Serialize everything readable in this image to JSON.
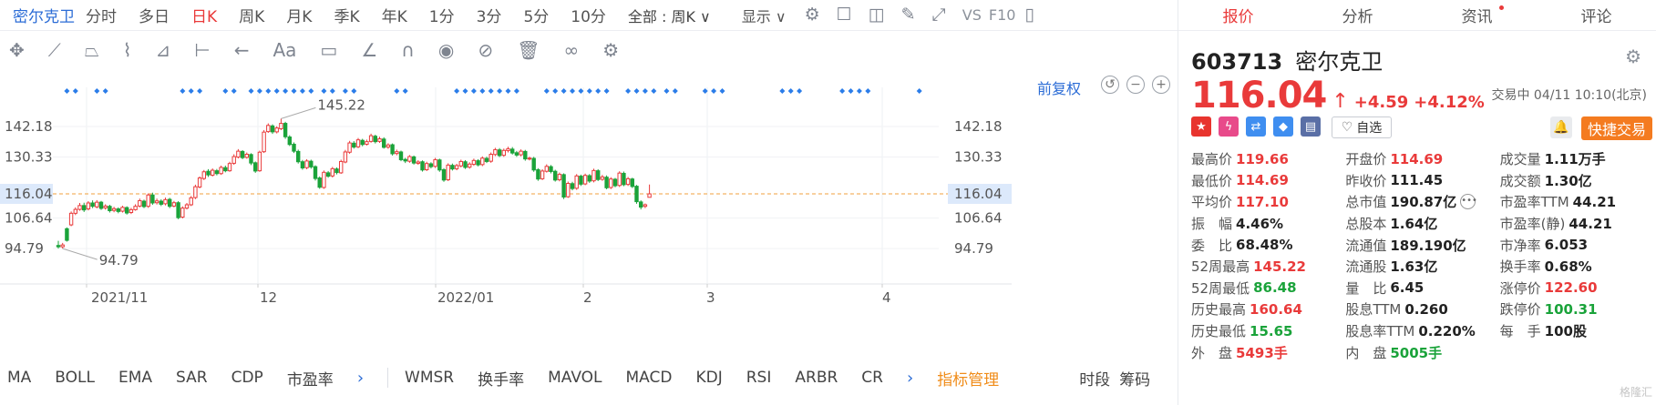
{
  "stock": {
    "name": "密尔克卫",
    "code": "603713"
  },
  "period_bar": {
    "periods": [
      "分时",
      "多日",
      "日K",
      "周K",
      "月K",
      "季K",
      "年K",
      "1分",
      "3分",
      "5分",
      "10分"
    ],
    "active_period": "日K",
    "range_select": "全部 : 周K ∨",
    "display_label": "显示 ∨",
    "vs_label": "VS",
    "f10_label": "F10"
  },
  "chart": {
    "adjust_label": "前复权",
    "price_labels": [
      "142.18",
      "130.33",
      "116.04",
      "106.64",
      "94.79"
    ],
    "current_price_tag": "116.04",
    "high_annotation": "145.22",
    "low_annotation": "94.79",
    "x_labels": [
      "2021/11",
      "12",
      "2022/01",
      "2",
      "3",
      "4"
    ],
    "colors": {
      "up": "#e93a3a",
      "down": "#1aa33a",
      "signal": "#2b7de9",
      "reference_line": "#f0a03c",
      "price_tag_bg": "#dce9fb"
    }
  },
  "chart_data": {
    "type": "candlestick",
    "x_labels": [
      "2021/11",
      "12",
      "2022/01",
      "2",
      "3",
      "4"
    ],
    "y_ticks": [
      142.18,
      130.33,
      116.04,
      106.64,
      94.79
    ],
    "high": 145.22,
    "low": 94.79,
    "current": 116.04,
    "candles": [
      [
        96.0,
        95.5,
        97.8,
        94.8
      ],
      [
        95.5,
        96.2,
        97.0,
        94.79
      ],
      [
        102.5,
        98.0,
        103.0,
        97.5
      ],
      [
        104.0,
        108.5,
        109.2,
        103.5
      ],
      [
        108.5,
        110.0,
        110.8,
        107.8
      ],
      [
        110.0,
        111.5,
        112.5,
        109.5
      ],
      [
        111.5,
        109.8,
        112.6,
        109.0
      ],
      [
        110.2,
        112.5,
        113.2,
        109.6
      ],
      [
        112.5,
        111.2,
        113.5,
        110.5
      ],
      [
        111.0,
        112.8,
        113.6,
        110.4
      ],
      [
        112.8,
        110.4,
        113.3,
        109.8
      ],
      [
        110.6,
        111.3,
        112.0,
        109.9
      ],
      [
        111.2,
        109.5,
        111.8,
        108.8
      ],
      [
        109.6,
        110.3,
        111.0,
        108.9
      ],
      [
        110.2,
        109.2,
        110.8,
        108.5
      ],
      [
        109.3,
        110.8,
        111.4,
        108.8
      ],
      [
        110.7,
        108.6,
        111.2,
        108.0
      ],
      [
        108.8,
        109.9,
        110.6,
        108.2
      ],
      [
        109.9,
        111.2,
        112.0,
        109.5
      ],
      [
        111.3,
        113.4,
        114.2,
        110.8
      ],
      [
        113.2,
        111.1,
        113.8,
        110.5
      ],
      [
        111.2,
        115.6,
        116.2,
        110.6
      ],
      [
        115.6,
        112.5,
        116.5,
        111.8
      ],
      [
        112.6,
        113.3,
        114.2,
        111.9
      ],
      [
        113.2,
        112.0,
        113.9,
        111.3
      ],
      [
        112.2,
        113.8,
        114.6,
        111.6
      ],
      [
        113.9,
        111.2,
        114.5,
        110.5
      ],
      [
        111.3,
        112.6,
        113.3,
        110.8
      ],
      [
        112.6,
        106.8,
        113.2,
        106.2
      ],
      [
        107.0,
        110.5,
        111.2,
        106.5
      ],
      [
        110.5,
        111.8,
        112.5,
        110.0
      ],
      [
        111.8,
        114.5,
        115.2,
        111.3
      ],
      [
        114.6,
        118.8,
        119.6,
        114.0
      ],
      [
        118.7,
        122.2,
        122.8,
        118.2
      ],
      [
        122.0,
        124.6,
        125.3,
        121.4
      ],
      [
        124.8,
        123.4,
        125.6,
        122.6
      ],
      [
        123.3,
        125.2,
        125.9,
        122.8
      ],
      [
        125.0,
        123.9,
        125.7,
        123.2
      ],
      [
        123.9,
        126.3,
        127.0,
        123.4
      ],
      [
        126.2,
        125.0,
        127.0,
        124.4
      ],
      [
        125.0,
        127.8,
        128.5,
        124.6
      ],
      [
        127.9,
        130.5,
        131.4,
        127.3
      ],
      [
        130.3,
        132.6,
        133.4,
        129.8
      ],
      [
        132.5,
        130.1,
        133.0,
        129.5
      ],
      [
        130.2,
        131.4,
        132.1,
        129.7
      ],
      [
        131.3,
        128.0,
        131.8,
        127.2
      ],
      [
        128.1,
        124.9,
        128.6,
        124.2
      ],
      [
        125.0,
        132.2,
        132.8,
        124.6
      ],
      [
        132.4,
        140.0,
        140.8,
        131.9
      ],
      [
        140.2,
        142.6,
        143.4,
        139.7
      ],
      [
        142.4,
        140.1,
        143.0,
        139.3
      ],
      [
        140.1,
        141.6,
        142.3,
        139.5
      ],
      [
        141.3,
        143.4,
        145.22,
        140.8
      ],
      [
        143.4,
        138.2,
        144.0,
        137.4
      ],
      [
        138.1,
        135.2,
        138.8,
        134.6
      ],
      [
        135.3,
        132.6,
        136.0,
        131.9
      ],
      [
        132.5,
        128.5,
        133.2,
        127.8
      ],
      [
        128.5,
        126.1,
        129.2,
        125.4
      ],
      [
        126.2,
        128.8,
        129.5,
        125.6
      ],
      [
        128.7,
        126.5,
        129.3,
        125.8
      ],
      [
        126.6,
        122.0,
        127.1,
        121.2
      ],
      [
        122.2,
        118.6,
        122.8,
        118.0
      ],
      [
        118.5,
        124.4,
        125.1,
        118.0
      ],
      [
        124.2,
        122.9,
        124.9,
        122.3
      ],
      [
        123.0,
        125.8,
        126.5,
        122.4
      ],
      [
        125.7,
        124.3,
        126.3,
        123.6
      ],
      [
        124.2,
        128.6,
        129.3,
        123.8
      ],
      [
        128.4,
        132.3,
        133.1,
        127.9
      ],
      [
        132.2,
        135.8,
        136.6,
        131.6
      ],
      [
        135.7,
        134.2,
        136.5,
        133.6
      ],
      [
        134.3,
        137.0,
        137.7,
        133.8
      ],
      [
        136.8,
        135.2,
        137.4,
        134.5
      ],
      [
        135.3,
        136.3,
        137.1,
        134.8
      ],
      [
        136.4,
        138.6,
        139.4,
        135.9
      ],
      [
        138.4,
        136.3,
        139.0,
        135.6
      ],
      [
        136.4,
        137.4,
        138.2,
        135.8
      ],
      [
        137.3,
        134.1,
        138.0,
        133.6
      ],
      [
        134.2,
        135.0,
        135.7,
        133.5
      ],
      [
        135.1,
        131.6,
        135.6,
        130.9
      ],
      [
        131.7,
        132.4,
        133.2,
        131.0
      ],
      [
        132.3,
        129.3,
        132.8,
        128.7
      ],
      [
        129.4,
        128.8,
        130.0,
        128.0
      ],
      [
        128.7,
        130.5,
        131.1,
        128.1
      ],
      [
        130.4,
        128.0,
        130.9,
        127.4
      ],
      [
        127.9,
        128.4,
        129.1,
        127.3
      ],
      [
        128.5,
        125.3,
        129.0,
        124.7
      ],
      [
        125.4,
        127.8,
        128.5,
        124.9
      ],
      [
        127.7,
        126.6,
        128.3,
        125.9
      ],
      [
        126.7,
        129.3,
        130.0,
        126.1
      ],
      [
        129.2,
        125.3,
        129.7,
        124.6
      ],
      [
        125.4,
        121.4,
        126.0,
        120.7
      ],
      [
        121.5,
        127.2,
        127.9,
        121.0
      ],
      [
        127.1,
        125.7,
        127.8,
        125.1
      ],
      [
        125.8,
        127.0,
        127.7,
        125.2
      ],
      [
        126.9,
        128.6,
        129.3,
        126.3
      ],
      [
        128.5,
        126.3,
        129.1,
        125.7
      ],
      [
        126.4,
        127.6,
        128.3,
        125.8
      ],
      [
        127.5,
        129.0,
        129.7,
        126.9
      ],
      [
        128.9,
        127.3,
        129.5,
        126.7
      ],
      [
        127.4,
        129.9,
        130.6,
        126.8
      ],
      [
        129.8,
        128.6,
        130.5,
        128.0
      ],
      [
        128.7,
        131.4,
        132.1,
        128.1
      ],
      [
        131.3,
        133.2,
        133.9,
        130.7
      ],
      [
        133.1,
        130.9,
        133.8,
        130.3
      ],
      [
        131.0,
        132.9,
        133.6,
        130.4
      ],
      [
        132.8,
        133.5,
        134.3,
        132.1
      ],
      [
        133.4,
        131.9,
        134.2,
        131.3
      ],
      [
        132.0,
        131.1,
        132.7,
        130.4
      ],
      [
        131.2,
        132.6,
        133.3,
        130.6
      ],
      [
        132.5,
        129.6,
        133.1,
        128.9
      ],
      [
        129.7,
        129.9,
        130.5,
        129.0
      ],
      [
        129.8,
        125.3,
        130.4,
        124.6
      ],
      [
        125.4,
        121.8,
        126.0,
        121.1
      ],
      [
        121.9,
        124.9,
        125.6,
        121.4
      ],
      [
        124.8,
        126.7,
        127.5,
        124.3
      ],
      [
        126.6,
        124.7,
        127.2,
        124.0
      ],
      [
        124.8,
        121.4,
        125.4,
        120.8
      ],
      [
        121.5,
        123.6,
        124.3,
        120.9
      ],
      [
        123.5,
        114.8,
        124.0,
        114.0
      ],
      [
        114.9,
        120.1,
        120.8,
        114.5
      ],
      [
        120.0,
        118.1,
        120.7,
        117.4
      ],
      [
        118.2,
        123.0,
        123.7,
        117.6
      ],
      [
        122.9,
        119.8,
        123.5,
        119.1
      ],
      [
        119.9,
        123.2,
        123.9,
        119.4
      ],
      [
        123.1,
        121.0,
        123.7,
        120.3
      ],
      [
        121.1,
        125.1,
        125.8,
        120.5
      ],
      [
        125.0,
        121.6,
        125.6,
        121.0
      ],
      [
        121.7,
        122.6,
        123.4,
        121.1
      ],
      [
        122.5,
        118.4,
        123.2,
        117.8
      ],
      [
        118.5,
        121.8,
        122.5,
        117.9
      ],
      [
        121.7,
        119.2,
        122.2,
        118.6
      ],
      [
        119.3,
        124.1,
        124.8,
        118.7
      ],
      [
        124.0,
        119.6,
        124.7,
        119.0
      ],
      [
        119.7,
        121.9,
        122.6,
        119.1
      ],
      [
        121.8,
        118.9,
        122.3,
        118.3
      ],
      [
        119.0,
        113.0,
        119.5,
        112.2
      ],
      [
        112.9,
        110.9,
        113.5,
        110.0
      ],
      [
        111.2,
        111.8,
        112.3,
        110.5
      ],
      [
        114.69,
        116.04,
        119.66,
        114.69
      ]
    ],
    "signal_marks": [
      [
        2,
        4
      ],
      [
        9,
        11
      ],
      [
        29,
        34
      ],
      [
        39,
        42
      ],
      [
        45,
        59
      ],
      [
        62,
        64
      ],
      [
        67,
        69
      ],
      [
        79,
        82
      ],
      [
        93,
        108
      ],
      [
        114,
        129
      ],
      [
        133,
        139
      ],
      [
        142,
        145
      ],
      [
        151,
        155
      ],
      [
        169,
        174
      ],
      [
        183,
        189
      ],
      [
        201,
        202
      ]
    ]
  },
  "indicators": {
    "left": [
      "MA",
      "BOLL",
      "EMA",
      "SAR",
      "CDP",
      "市盈率"
    ],
    "right": [
      "WMSR",
      "换手率",
      "MAVOL",
      "MACD",
      "KDJ",
      "RSI",
      "ARBR",
      "CR"
    ],
    "manager": "指标管理",
    "tail": [
      "时段",
      "筹码"
    ]
  },
  "panel": {
    "tabs": [
      "报价",
      "分析",
      "资讯",
      "评论"
    ],
    "active_tab": "报价",
    "price": "116.04",
    "price_arrow": "↑",
    "change": "+4.59",
    "change_pct": "+4.12%",
    "trade_time": "交易中 04/11 10:10(北京)",
    "watch_label": "自选",
    "quick_trade": "快捷交易",
    "badges": [
      {
        "icon": "china-flag-icon",
        "char": "★",
        "color": "#e8342e"
      },
      {
        "icon": "margin-icon",
        "char": "ϟ",
        "color": "#e84a8a"
      },
      {
        "icon": "connect-icon",
        "char": "⇄",
        "color": "#3f8ef0"
      },
      {
        "icon": "tag-icon",
        "char": "◆",
        "color": "#3f8ef0"
      },
      {
        "icon": "report-icon",
        "char": "▤",
        "color": "#5a6fa6"
      }
    ],
    "stats": [
      [
        {
          "label": "最高价",
          "value": "119.66",
          "tone": "red"
        },
        {
          "label": "开盘价",
          "value": "114.69",
          "tone": "red"
        },
        {
          "label": "成交量",
          "value": "1.11万手",
          "tone": ""
        }
      ],
      [
        {
          "label": "最低价",
          "value": "114.69",
          "tone": "red"
        },
        {
          "label": "昨收价",
          "value": "111.45",
          "tone": ""
        },
        {
          "label": "成交额",
          "value": "1.30亿",
          "tone": ""
        }
      ],
      [
        {
          "label": "平均价",
          "value": "117.10",
          "tone": "red"
        },
        {
          "label": "总市值",
          "value": "190.87亿",
          "tone": ""
        },
        {
          "label": "市盈率TTM",
          "value": "44.21",
          "tone": ""
        }
      ],
      [
        {
          "label": "振　幅",
          "value": "4.46%",
          "tone": ""
        },
        {
          "label": "总股本",
          "value": "1.64亿",
          "tone": ""
        },
        {
          "label": "市盈率(静)",
          "value": "44.21",
          "tone": ""
        }
      ],
      [
        {
          "label": "委　比",
          "value": "68.48%",
          "tone": ""
        },
        {
          "label": "流通值",
          "value": "189.190亿",
          "tone": ""
        },
        {
          "label": "市净率",
          "value": "6.053",
          "tone": ""
        }
      ],
      [
        {
          "label": "52周最高",
          "value": "145.22",
          "tone": "red"
        },
        {
          "label": "流通股",
          "value": "1.63亿",
          "tone": ""
        },
        {
          "label": "换手率",
          "value": "0.68%",
          "tone": ""
        }
      ],
      [
        {
          "label": "52周最低",
          "value": "86.48",
          "tone": "green"
        },
        {
          "label": "量　比",
          "value": "6.45",
          "tone": ""
        },
        {
          "label": "涨停价",
          "value": "122.60",
          "tone": "red"
        }
      ],
      [
        {
          "label": "历史最高",
          "value": "160.64",
          "tone": "red"
        },
        {
          "label": "股息TTM",
          "value": "0.260",
          "tone": ""
        },
        {
          "label": "跌停价",
          "value": "100.31",
          "tone": "green"
        }
      ],
      [
        {
          "label": "历史最低",
          "value": "15.65",
          "tone": "green"
        },
        {
          "label": "股息率TTM",
          "value": "0.220%",
          "tone": ""
        },
        {
          "label": "每　手",
          "value": "100股",
          "tone": ""
        }
      ],
      [
        {
          "label": "外　盘",
          "value": "5493手",
          "tone": "red"
        },
        {
          "label": "内　盘",
          "value": "5005手",
          "tone": "green"
        },
        {
          "label": "",
          "value": "",
          "tone": ""
        }
      ]
    ],
    "watermark": "格隆汇"
  }
}
